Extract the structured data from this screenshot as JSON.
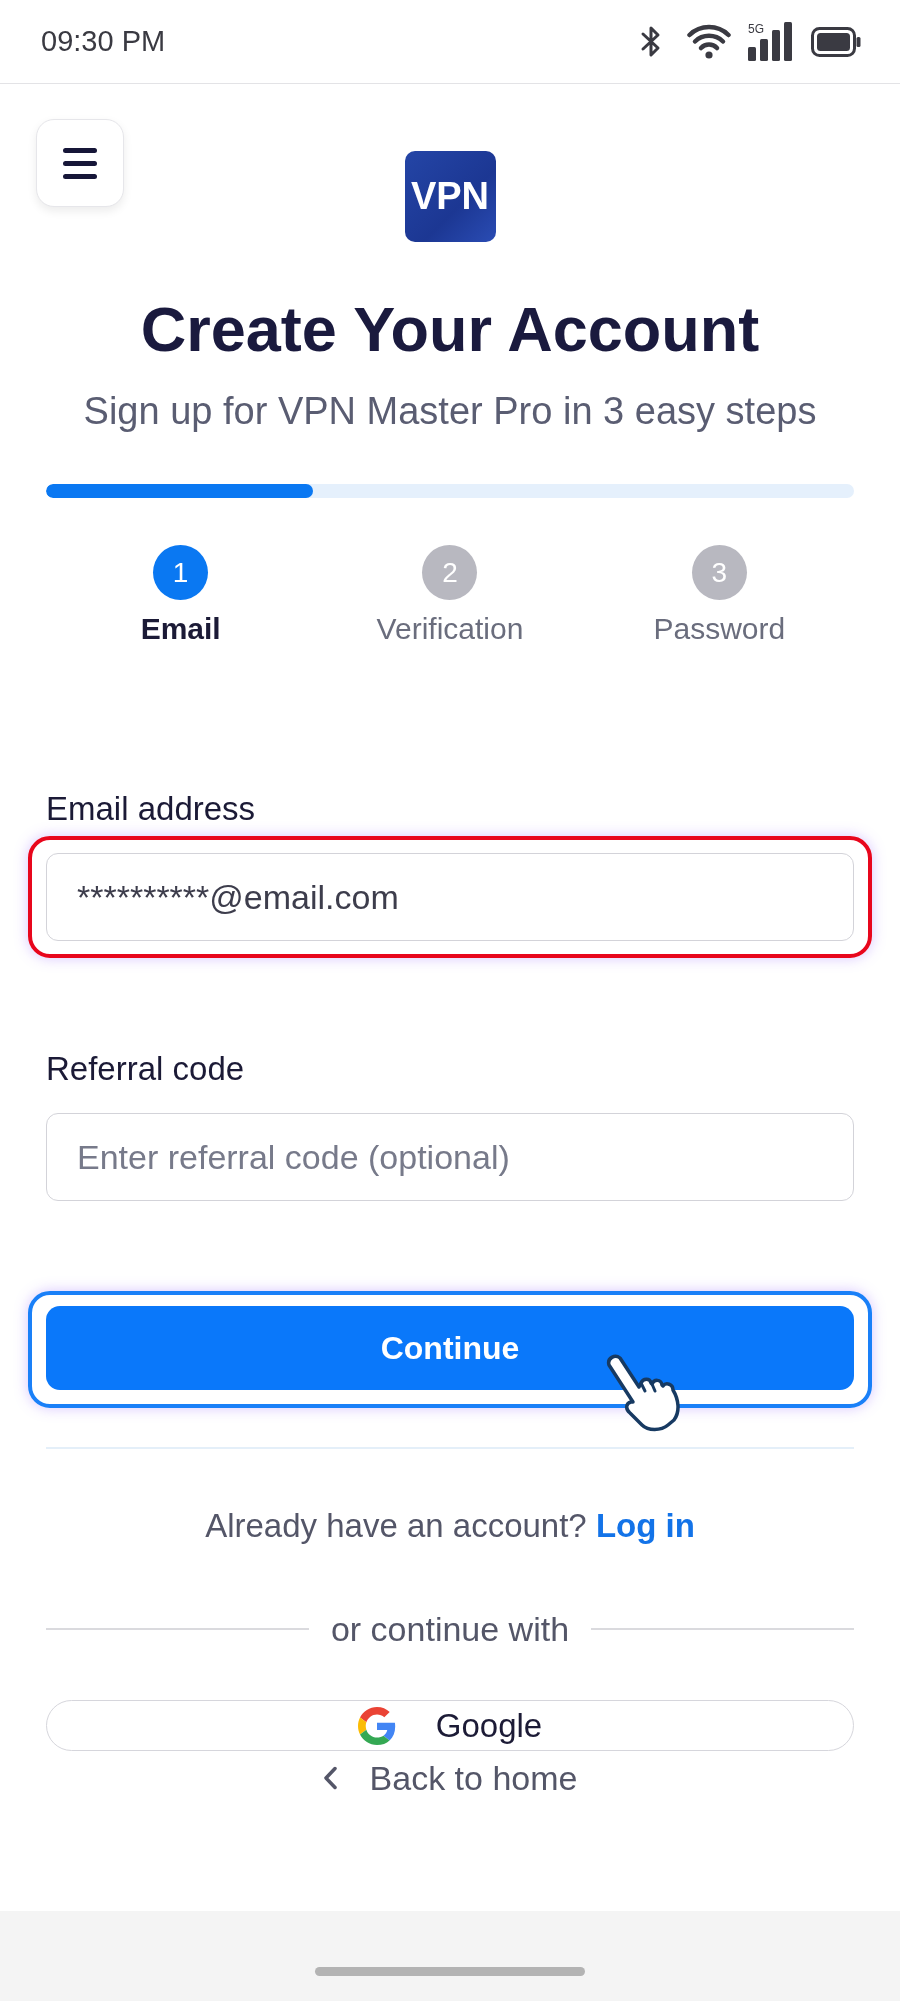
{
  "status_bar": {
    "time": "09:30 PM",
    "network": "5G"
  },
  "header": {
    "logo": "VPN",
    "title": "Create Your Account",
    "subtitle": "Sign up for VPN Master Pro in 3 easy steps"
  },
  "progress": {
    "level": 0.33
  },
  "steps": [
    {
      "number": "1",
      "label": "Email",
      "selected": true
    },
    {
      "number": "2",
      "label": "Verification",
      "selected": false
    },
    {
      "number": "3",
      "label": "Password",
      "selected": false
    }
  ],
  "fields": [
    {
      "label": "Email address",
      "value": "**********@email.com",
      "highlighted": true
    },
    {
      "label": "Referral code",
      "placeholder": "Enter referral code (optional)",
      "highlighted": false
    }
  ],
  "continue_button": {
    "label": "Continue",
    "highlighted": true,
    "tap_cursor": true
  },
  "login_prompt": {
    "text": "Already have an account?",
    "link": "Log in"
  },
  "divider_label": "or continue with",
  "google_button": {
    "label": "Google"
  },
  "back_link": {
    "label": "Back to home"
  }
}
